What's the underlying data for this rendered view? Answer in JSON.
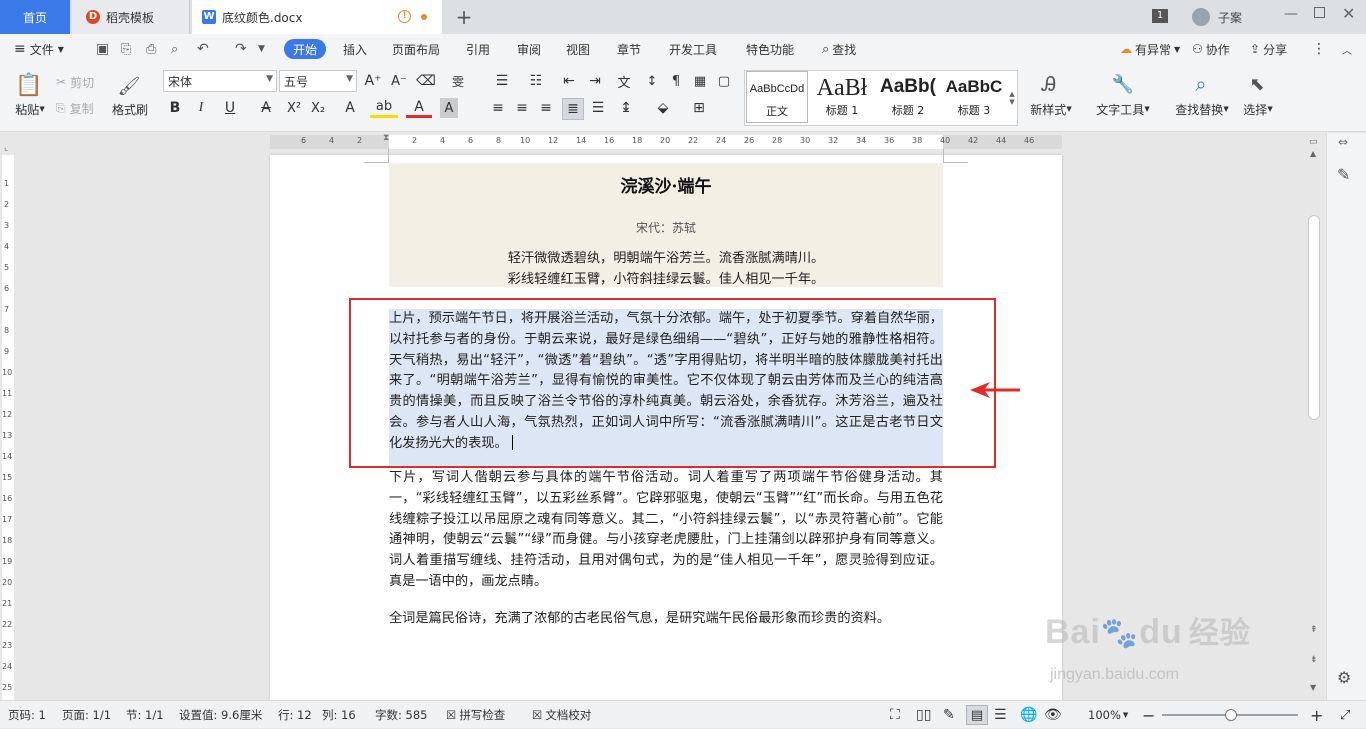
{
  "tabs": {
    "home": "首页",
    "template": "稻壳模板",
    "doc": "底纹颜色.docx",
    "page_num": "1",
    "user": "子案"
  },
  "menu": {
    "file": "文件",
    "items": [
      "开始",
      "插入",
      "页面布局",
      "引用",
      "审阅",
      "视图",
      "章节",
      "开发工具",
      "特色功能"
    ],
    "search": "查找",
    "right": [
      "有异常",
      "协作",
      "分享"
    ]
  },
  "ribbon": {
    "paste": "粘贴",
    "cut": "剪切",
    "copy": "复制",
    "format_painter": "格式刷",
    "font_name": "宋体",
    "font_size": "五号",
    "styles": [
      {
        "preview": "AaBbCcDd",
        "name": "正文"
      },
      {
        "preview": "AaBł",
        "name": "标题 1"
      },
      {
        "preview": "AaBb(",
        "name": "标题 2"
      },
      {
        "preview": "AaBbC",
        "name": "标题 3"
      }
    ],
    "new_style": "新样式",
    "text_tools": "文字工具",
    "find_replace": "查找替换",
    "select": "选择"
  },
  "ruler_h": [
    "6",
    "4",
    "2",
    "",
    "2",
    "4",
    "6",
    "8",
    "10",
    "12",
    "14",
    "16",
    "18",
    "20",
    "22",
    "24",
    "26",
    "28",
    "30",
    "32",
    "34",
    "36",
    "38",
    "40",
    "42",
    "44",
    "46"
  ],
  "ruler_v": [
    "1",
    "1",
    "2",
    "3",
    "4",
    "5",
    "6",
    "7",
    "8",
    "9",
    "10",
    "11",
    "12",
    "13",
    "14",
    "15",
    "16",
    "17",
    "18",
    "19",
    "20",
    "21",
    "22",
    "23",
    "24",
    "25"
  ],
  "document": {
    "title": "浣溪沙·端午",
    "author": "宋代：苏轼",
    "line1": "轻汗微微透碧纨，明朝端午浴芳兰。流香涨腻满晴川。",
    "line2": "彩线轻缠红玉臂，小符斜挂绿云鬟。佳人相见一千年。",
    "para1": "上片，预示端午节日，将开展浴兰活动，气氛十分浓郁。端午，处于初夏季节。穿着自然华丽，以衬托参与者的身份。于朝云来说，最好是绿色细绢——“碧纨”，正好与她的雅静性格相符。天气稍热，易出“轻汗”，“微透”着“碧纨”。“透”字用得贴切，将半明半暗的肢体朦胧美衬托出来了。“明朝端午浴芳兰”，显得有愉悦的审美性。它不仅体现了朝云由芳体而及兰心的纯洁高贵的情操美，而且反映了浴兰令节俗的淳朴纯真美。朝云浴处，余香犹存。沐芳浴兰，遍及社会。参与者人山人海，气氛热烈，正如词人词中所写：“流香涨腻满晴川”。这正是古老节日文化发扬光大的表现。",
    "para2": "下片，写词人偕朝云参与具体的端午节俗活动。词人着重写了两项端午节俗健身活动。其一，“彩线轻缠红玉臂”，以五彩丝系臂”。它辟邪驱鬼，使朝云“玉臂”“红”而长命。与用五色花线缠粽子投江以吊屈原之魂有同等意义。其二，“小符斜挂绿云鬟”，以“赤灵符著心前”。它能通神明，使朝云“云鬟”“绿”而身健。与小孩穿老虎腰肚，门上挂蒲剑以辟邪护身有同等意义。词人着重描写缠线、挂符活动，且用对偶句式，为的是“佳人相见一千年”，愿灵验得到应证。真是一语中的，画龙点睛。",
    "para3": "全词是篇民俗诗，充满了浓郁的古老民俗气息，是研究端午民俗最形象而珍贵的资料。"
  },
  "status": {
    "page_label": "页码: 1",
    "pages": "页面: 1/1",
    "section": "节: 1/1",
    "setting": "设置值: 9.6厘米",
    "row": "行: 12",
    "col": "列: 16",
    "words": "字数: 585",
    "spell": "拼写检查",
    "proof": "文档校对",
    "zoom": "100%"
  },
  "watermark": {
    "brand": "Bai",
    "paw": "du",
    "cn": "经验",
    "url": "jingyan.baidu.com"
  },
  "colors": {
    "accent": "#3b79e8",
    "highlight": "#dce6f4",
    "red": "#e02b2b",
    "poem_bg": "#f2efe4"
  }
}
